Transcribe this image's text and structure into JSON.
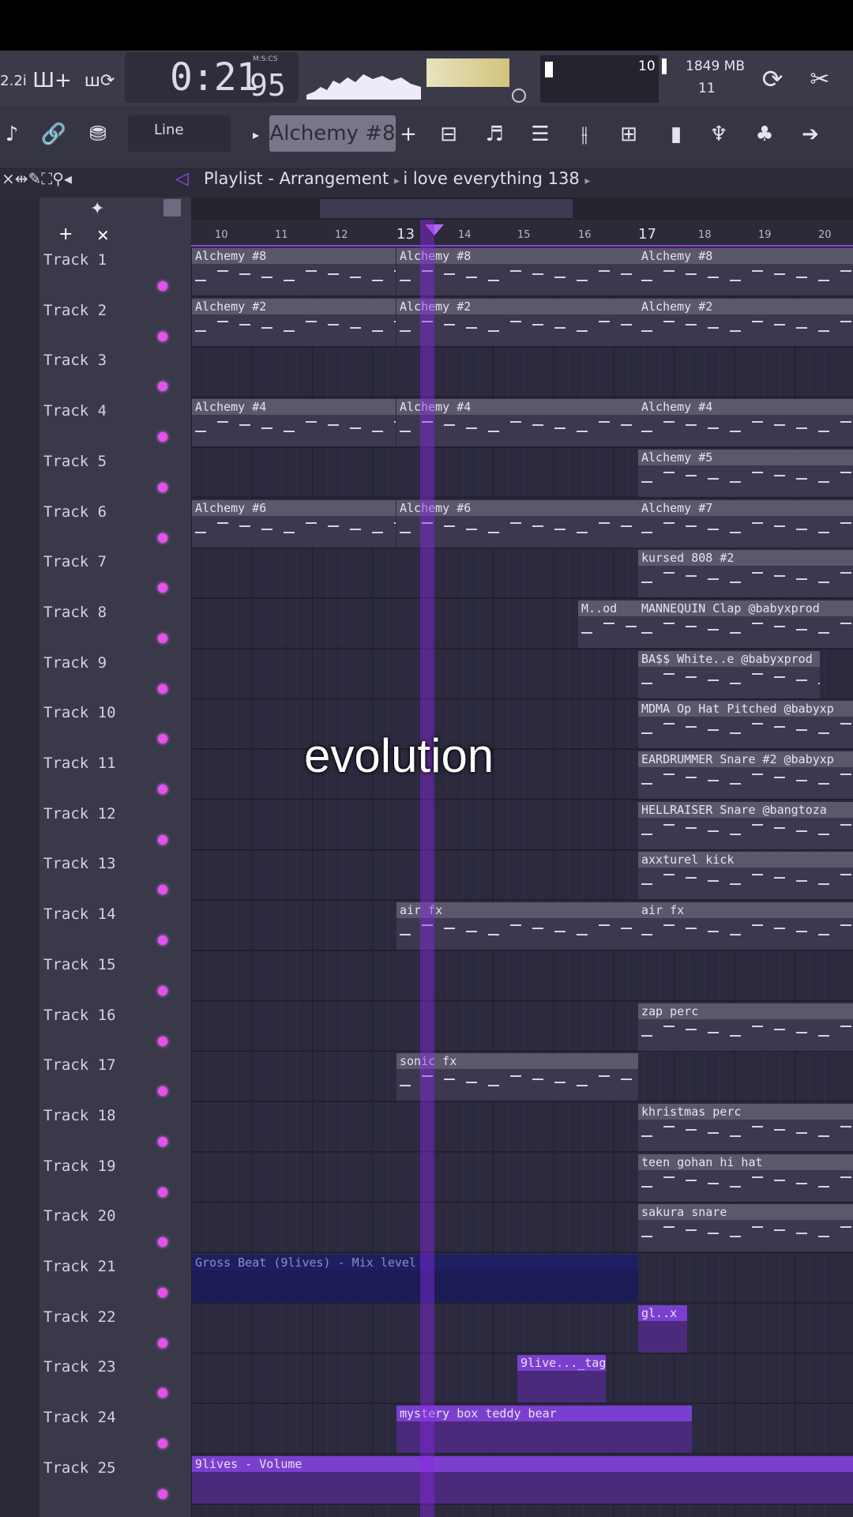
{
  "toolbar": {
    "time": "0:21",
    "time_fraction": "95",
    "time_format": "M:S:CS",
    "memory": "1849 MB",
    "cpu_top": "10",
    "cpu_bottom": "11",
    "snap_mode": "Line",
    "pattern": "Alchemy #8",
    "left_label": "2.2i"
  },
  "breadcrumb": {
    "root": "Playlist - Arrangement",
    "project": "i love everything 138"
  },
  "ruler": [
    "10",
    "11",
    "12",
    "13",
    "14",
    "15",
    "16",
    "17",
    "18",
    "19",
    "20"
  ],
  "tracks": [
    "Track 1",
    "Track 2",
    "Track 3",
    "Track 4",
    "Track 5",
    "Track 6",
    "Track 7",
    "Track 8",
    "Track 9",
    "Track 10",
    "Track 11",
    "Track 12",
    "Track 13",
    "Track 14",
    "Track 15",
    "Track 16",
    "Track 17",
    "Track 18",
    "Track 19",
    "Track 20",
    "Track 21",
    "Track 22",
    "Track 23",
    "Track 24",
    "Track 25"
  ],
  "clips": {
    "t1a": "Alchemy #8",
    "t1b": "Alchemy #8",
    "t1c": "Alchemy #8",
    "t2a": "Alchemy #2",
    "t2b": "Alchemy #2",
    "t2c": "Alchemy #2",
    "t4a": "Alchemy #4",
    "t4b": "Alchemy #4",
    "t4c": "Alchemy #4",
    "t5": "Alchemy #5",
    "t6a": "Alchemy #6",
    "t6b": "Alchemy #6",
    "t6c": "Alchemy #7",
    "t7": "kursed 808 #2",
    "t8a": "M..od",
    "t8b": "MANNEQUIN Clap @babyxprod",
    "t9": "BA$$ White..e @babyxprod",
    "t10": "MDMA Op Hat Pitched @babyxp",
    "t11": "EARDRUMMER Snare #2 @babyxp",
    "t12": "HELLRAISER Snare @bangtoza",
    "t13": "axxturel kick",
    "t14a": "air fx",
    "t14b": "air fx",
    "t16": "zap perc",
    "t17": "sonic fx",
    "t18": "khristmas perc",
    "t19": "teen gohan hi hat",
    "t20": "sakura snare",
    "t21": "Gross Beat (9lives) - Mix level",
    "t22": "gl..x",
    "t23": "9live..._tag",
    "t24": "mystery box teddy bear",
    "t25": "9lives - Volume"
  },
  "overlay": "evolution"
}
